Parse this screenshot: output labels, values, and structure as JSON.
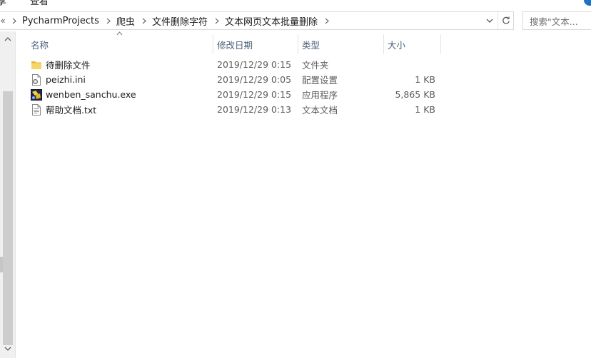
{
  "ribbon": {
    "partial_left": "享",
    "partial_view": "查看"
  },
  "address": {
    "overflow": "«",
    "crumbs": [
      "PycharmProjects",
      "爬虫",
      "文件删除字符",
      "文本网页文本批量删除"
    ]
  },
  "search": {
    "placeholder": "搜索\"文本..."
  },
  "columns": {
    "name": "名称",
    "date": "修改日期",
    "type": "类型",
    "size": "大小"
  },
  "files": [
    {
      "name": "待删除文件",
      "date": "2019/12/29 0:15",
      "type": "文件夹",
      "size": "",
      "icon": "folder-icon"
    },
    {
      "name": "peizhi.ini",
      "date": "2019/12/29 0:05",
      "type": "配置设置",
      "size": "1 KB",
      "icon": "ini-file-icon"
    },
    {
      "name": "wenben_sanchu.exe",
      "date": "2019/12/29 0:15",
      "type": "应用程序",
      "size": "5,865 KB",
      "icon": "exe-file-icon"
    },
    {
      "name": "帮助文档.txt",
      "date": "2019/12/29 0:13",
      "type": "文本文档",
      "size": "1 KB",
      "icon": "text-file-icon"
    }
  ],
  "colors": {
    "header_text": "#4c607a",
    "folder": "#f4c84a",
    "accent": "#1a73c7"
  }
}
